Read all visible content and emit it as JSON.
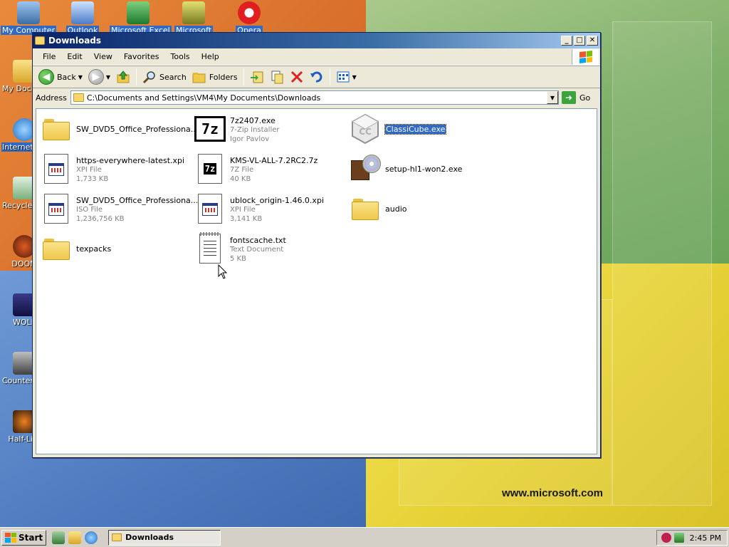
{
  "desktop": {
    "top_icons": [
      "My Computer",
      "Outlook",
      "Microsoft Excel",
      "Microsoft",
      "Opera"
    ],
    "left_icons": [
      "My Documents",
      "Internet Explorer",
      "Recycle Bin",
      "DOOM",
      "WOLF",
      "Counter-Strike",
      "Half-Life"
    ],
    "wallpaper_text": "www.microsoft.com"
  },
  "window": {
    "title": "Downloads",
    "menu": [
      "File",
      "Edit",
      "View",
      "Favorites",
      "Tools",
      "Help"
    ],
    "toolbar": {
      "back": "Back",
      "search": "Search",
      "folders": "Folders"
    },
    "address": {
      "label": "Address",
      "value": "C:\\Documents and Settings\\VM4\\My Documents\\Downloads",
      "go": "Go"
    },
    "files": [
      {
        "name": "SW_DVD5_Office_Professiona...",
        "type": "",
        "size": "",
        "icon": "folder-icon"
      },
      {
        "name": "7z2407.exe",
        "type": "7-Zip Installer",
        "size": "Igor Pavlov",
        "icon": "7zip-icon"
      },
      {
        "name": "ClassiCube.exe",
        "type": "",
        "size": "",
        "icon": "classicube-icon"
      },
      {
        "name": "https-everywhere-latest.xpi",
        "type": "XPI File",
        "size": "1,733 KB",
        "icon": "xpi-file-icon"
      },
      {
        "name": "KMS-VL-ALL-7.2RC2.7z",
        "type": "7Z File",
        "size": "40 KB",
        "icon": "7z-file-icon"
      },
      {
        "name": "setup-hl1-won2.exe",
        "type": "",
        "size": "",
        "icon": "setup-icon"
      },
      {
        "name": "SW_DVD5_Office_Professiona...",
        "type": "ISO File",
        "size": "1,236,756 KB",
        "icon": "iso-file-icon"
      },
      {
        "name": "ublock_origin-1.46.0.xpi",
        "type": "XPI File",
        "size": "3,141 KB",
        "icon": "xpi-file-icon"
      },
      {
        "name": "audio",
        "type": "",
        "size": "",
        "icon": "folder-icon"
      },
      {
        "name": "texpacks",
        "type": "",
        "size": "",
        "icon": "folder-icon"
      },
      {
        "name": "fontscache.txt",
        "type": "Text Document",
        "size": "5 KB",
        "icon": "text-file-icon"
      }
    ]
  },
  "taskbar": {
    "start": "Start",
    "task": "Downloads",
    "clock": "2:45 PM"
  },
  "colors": {
    "selection": "#316ac5",
    "titlebar": "#0a246a",
    "window_bg": "#ece9d8"
  }
}
